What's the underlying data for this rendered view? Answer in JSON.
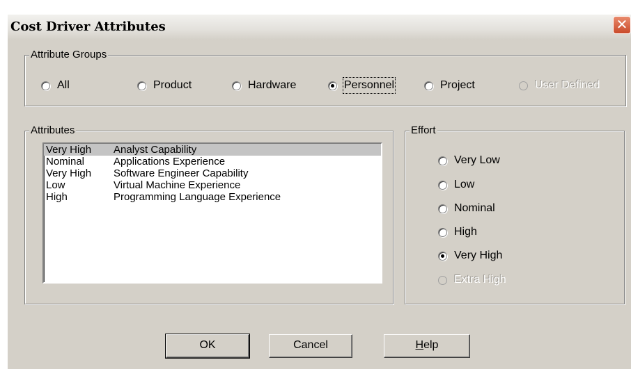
{
  "window": {
    "title": "Cost Driver Attributes",
    "close_icon": "close-icon"
  },
  "attribute_groups": {
    "legend": "Attribute Groups",
    "options": [
      {
        "label": "All",
        "checked": false,
        "enabled": true
      },
      {
        "label": "Product",
        "checked": false,
        "enabled": true
      },
      {
        "label": "Hardware",
        "checked": false,
        "enabled": true
      },
      {
        "label": "Personnel",
        "checked": true,
        "enabled": true
      },
      {
        "label": "Project",
        "checked": false,
        "enabled": true
      },
      {
        "label": "User Defined",
        "checked": false,
        "enabled": false
      }
    ]
  },
  "attributes": {
    "legend": "Attributes",
    "rows": [
      {
        "level": "Very High",
        "name": "Analyst Capability",
        "selected": true
      },
      {
        "level": "Nominal",
        "name": "Applications Experience",
        "selected": false
      },
      {
        "level": "Very High",
        "name": "Software Engineer Capability",
        "selected": false
      },
      {
        "level": "Low",
        "name": "Virtual Machine Experience",
        "selected": false
      },
      {
        "level": "High",
        "name": "Programming Language Experience",
        "selected": false
      }
    ]
  },
  "effort": {
    "legend": "Effort",
    "options": [
      {
        "label": "Very Low",
        "checked": false,
        "enabled": true
      },
      {
        "label": "Low",
        "checked": false,
        "enabled": true
      },
      {
        "label": "Nominal",
        "checked": false,
        "enabled": true
      },
      {
        "label": "High",
        "checked": false,
        "enabled": true
      },
      {
        "label": "Very High",
        "checked": true,
        "enabled": true
      },
      {
        "label": "Extra High",
        "checked": false,
        "enabled": false
      }
    ]
  },
  "buttons": {
    "ok": "OK",
    "cancel": "Cancel",
    "help_mnemonic": "H",
    "help_rest": "elp"
  }
}
